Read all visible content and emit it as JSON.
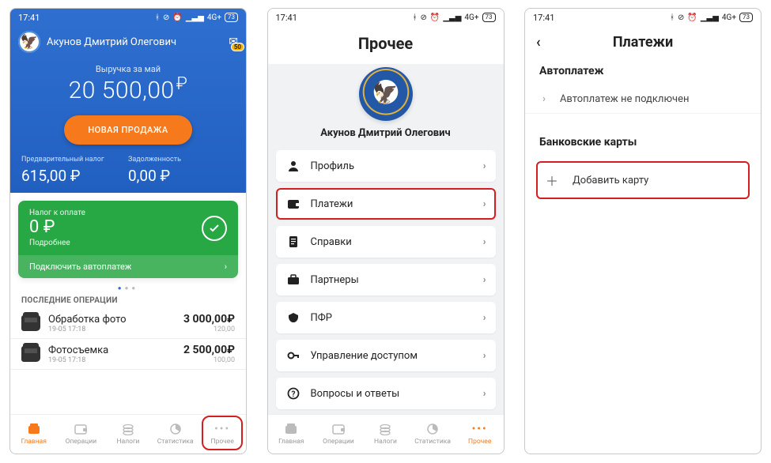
{
  "status": {
    "time": "17:41",
    "net": "4G+",
    "battery": "73"
  },
  "screen1": {
    "username": "Акунов Дмитрий Олегович",
    "mail_badge": "50",
    "revenue_label": "Выручка за май",
    "revenue_value": "20 500,00",
    "new_sale": "НОВАЯ ПРОДАЖА",
    "pre_tax_label": "Предварительный налог",
    "pre_tax_value": "615,00 ₽",
    "debt_label": "Задолженность",
    "debt_value": "0,00 ₽",
    "card_top": "Налог к оплате",
    "card_amount": "0 ₽",
    "card_more": "Подробнее",
    "card_foot": "Подключить автоплатеж",
    "ops_header": "ПОСЛЕДНИЕ ОПЕРАЦИИ",
    "ops": [
      {
        "title": "Обработка фото",
        "sub": "19-05 17:18",
        "amt": "3 000,00₽",
        "amt2": "120,00"
      },
      {
        "title": "Фотосъемка",
        "sub": "19-05 17:18",
        "amt": "2 500,00₽",
        "amt2": "100,00"
      }
    ]
  },
  "bottombar": {
    "items": [
      {
        "label": "Главная",
        "name": "tab-home"
      },
      {
        "label": "Операции",
        "name": "tab-ops"
      },
      {
        "label": "Налоги",
        "name": "tab-taxes"
      },
      {
        "label": "Статистика",
        "name": "tab-stats"
      },
      {
        "label": "Прочее",
        "name": "tab-other"
      }
    ]
  },
  "screen2": {
    "title": "Прочее",
    "username": "Акунов Дмитрий Олегович",
    "rows": [
      {
        "icon": "person",
        "label": "Профиль",
        "name": "menu-profile"
      },
      {
        "icon": "wallet",
        "label": "Платежи",
        "name": "menu-payments",
        "highlight": true
      },
      {
        "icon": "doc",
        "label": "Справки",
        "name": "menu-docs"
      },
      {
        "icon": "case",
        "label": "Партнеры",
        "name": "menu-partners"
      },
      {
        "icon": "pfr",
        "label": "ПФР",
        "name": "menu-pfr"
      },
      {
        "icon": "key",
        "label": "Управление доступом",
        "name": "menu-access"
      },
      {
        "icon": "help",
        "label": "Вопросы и ответы",
        "name": "menu-faq"
      }
    ]
  },
  "screen3": {
    "title": "Платежи",
    "section1": "Автоплатеж",
    "autopay_text": "Автоплатеж не подключен",
    "section2": "Банковские карты",
    "add_card": "Добавить карту"
  }
}
